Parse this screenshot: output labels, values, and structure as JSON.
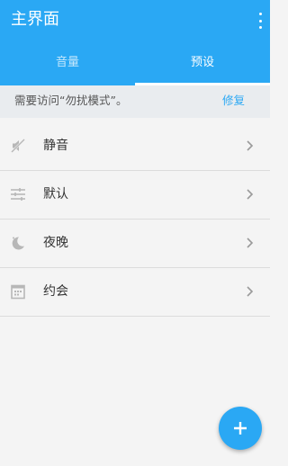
{
  "app": {
    "title": "主界面"
  },
  "tabs": [
    {
      "label": "音量",
      "active": false
    },
    {
      "label": "预设",
      "active": true
    }
  ],
  "notice": {
    "text": "需要访问“勿扰模式”。",
    "action": "修复"
  },
  "presets": [
    {
      "label": "静音",
      "icon": "muted-speaker-icon"
    },
    {
      "label": "默认",
      "icon": "sliders-icon"
    },
    {
      "label": "夜晚",
      "icon": "moon-icon"
    },
    {
      "label": "约会",
      "icon": "calendar-icon"
    }
  ],
  "colors": {
    "accent": "#2aa8f4",
    "background": "#f4f4f4",
    "notice_background": "#e9ecef"
  }
}
